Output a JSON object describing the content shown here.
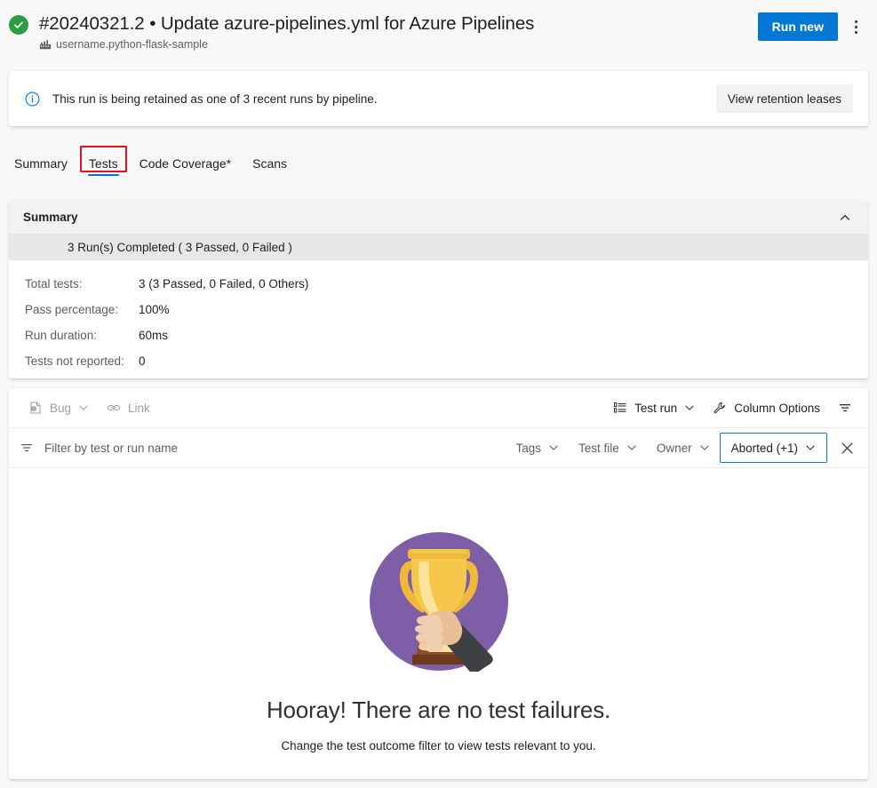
{
  "header": {
    "status_icon": "check-circle-icon",
    "run_title": "#20240321.2 • Update azure-pipelines.yml for Azure Pipelines",
    "pipeline_icon": "pipeline-icon",
    "pipeline_name": "username.python-flask-sample",
    "run_new_label": "Run new",
    "more_icon": "more-vertical-icon",
    "accent_color": "#0078d4",
    "success_color": "#2d9c41"
  },
  "banner": {
    "info_icon": "info-circle-icon",
    "message": "This run is being retained as one of 3 recent runs by pipeline.",
    "action_label": "View retention leases"
  },
  "tabs": {
    "items": [
      {
        "label": "Summary",
        "selected": false,
        "annotated": false
      },
      {
        "label": "Tests",
        "selected": true,
        "annotated": true
      },
      {
        "label": "Code Coverage*",
        "selected": false,
        "annotated": false
      },
      {
        "label": "Scans",
        "selected": false,
        "annotated": false
      }
    ],
    "annotation_color": "#e81123"
  },
  "summary": {
    "title": "Summary",
    "collapse_icon": "chevron-up-icon",
    "run_line": "3 Run(s) Completed ( 3 Passed, 0 Failed )",
    "stats": [
      {
        "label": "Total tests:",
        "value": "3 (3 Passed, 0 Failed, 0 Others)"
      },
      {
        "label": "Pass percentage:",
        "value": "100%"
      },
      {
        "label": "Run duration:",
        "value": "60ms"
      },
      {
        "label": "Tests not reported:",
        "value": "0"
      }
    ]
  },
  "toolbar": {
    "bug_label": "Bug",
    "bug_icon": "bug-icon",
    "link_label": "Link",
    "link_icon": "link-icon",
    "grouping_label": "Test run",
    "grouping_icon": "list-group-icon",
    "column_options_label": "Column Options",
    "column_options_icon": "wrench-icon",
    "filter_toggle_icon": "filter-icon"
  },
  "filterbar": {
    "filter_icon": "filter-icon",
    "search_placeholder": "Filter by test or run name",
    "search_value": "",
    "pills": [
      {
        "label": "Tags",
        "active": false
      },
      {
        "label": "Test file",
        "active": false
      },
      {
        "label": "Owner",
        "active": false
      },
      {
        "label": "Aborted (+1)",
        "active": true
      }
    ],
    "close_icon": "close-icon",
    "active_border_color": "#0078d4"
  },
  "empty_state": {
    "illustration": "trophy-in-hand-illustration",
    "circle_color": "#7f5ea8",
    "title": "Hooray! There are no test failures.",
    "subtitle": "Change the test outcome filter to view tests relevant to you."
  }
}
